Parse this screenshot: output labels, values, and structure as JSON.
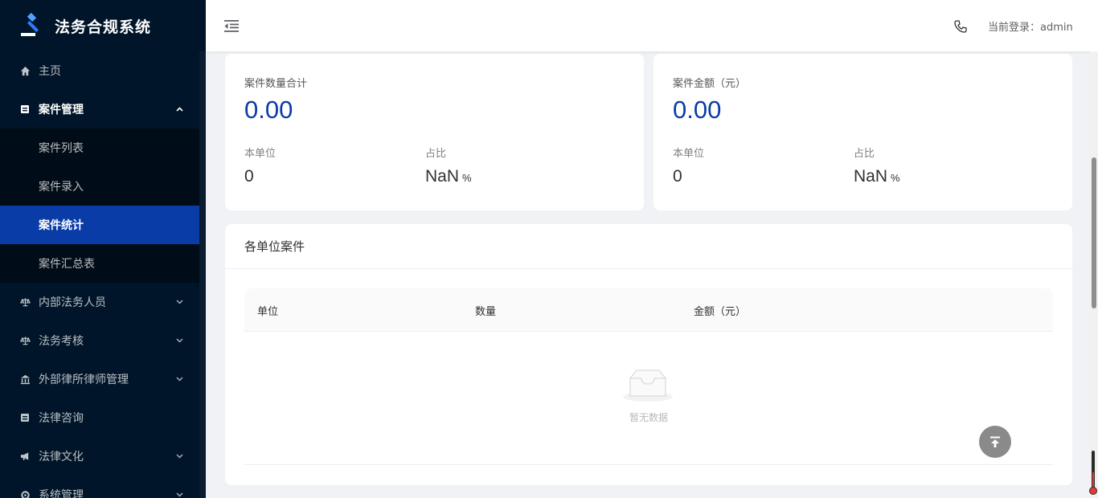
{
  "app": {
    "title": "法务合规系统"
  },
  "sidebar": {
    "items": [
      {
        "label": "主页",
        "icon": "home-icon"
      },
      {
        "label": "案件管理",
        "icon": "case-icon",
        "open": true,
        "children": [
          {
            "label": "案件列表"
          },
          {
            "label": "案件录入"
          },
          {
            "label": "案件统计",
            "active": true
          },
          {
            "label": "案件汇总表"
          }
        ]
      },
      {
        "label": "内部法务人员",
        "icon": "scale-icon"
      },
      {
        "label": "法务考核",
        "icon": "scale-icon"
      },
      {
        "label": "外部律所律师管理",
        "icon": "bank-icon"
      },
      {
        "label": "法律咨询",
        "icon": "case-icon"
      },
      {
        "label": "法律文化",
        "icon": "megaphone-icon"
      },
      {
        "label": "系统管理",
        "icon": "gear-icon"
      }
    ]
  },
  "header": {
    "login_text": "当前登录：admin"
  },
  "stats": {
    "count": {
      "title": "案件数量合计",
      "value": "0.00",
      "unit_label": "本单位",
      "unit_value": "0",
      "ratio_label": "占比",
      "ratio_value": "NaN",
      "ratio_unit": "%"
    },
    "amount": {
      "title": "案件金额（元）",
      "value": "0.00",
      "unit_label": "本单位",
      "unit_value": "0",
      "ratio_label": "占比",
      "ratio_value": "NaN",
      "ratio_unit": "%"
    }
  },
  "table": {
    "title": "各单位案件",
    "columns": [
      "单位",
      "数量",
      "金额（元）"
    ],
    "empty_text": "暂无数据"
  },
  "colors": {
    "sidebar_bg": "#001529",
    "active_menu": "#0a3ca8",
    "accent_value": "#0a3ca8"
  }
}
